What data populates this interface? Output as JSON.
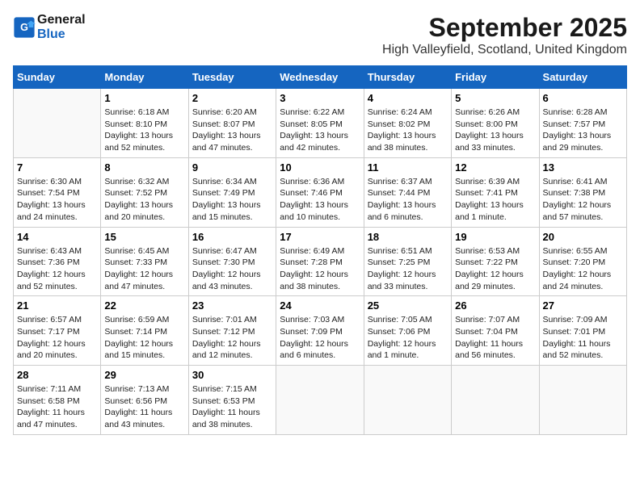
{
  "header": {
    "logo_line1": "General",
    "logo_line2": "Blue",
    "month": "September 2025",
    "location": "High Valleyfield, Scotland, United Kingdom"
  },
  "weekdays": [
    "Sunday",
    "Monday",
    "Tuesday",
    "Wednesday",
    "Thursday",
    "Friday",
    "Saturday"
  ],
  "weeks": [
    [
      {
        "day": "",
        "content": ""
      },
      {
        "day": "1",
        "content": "Sunrise: 6:18 AM\nSunset: 8:10 PM\nDaylight: 13 hours\nand 52 minutes."
      },
      {
        "day": "2",
        "content": "Sunrise: 6:20 AM\nSunset: 8:07 PM\nDaylight: 13 hours\nand 47 minutes."
      },
      {
        "day": "3",
        "content": "Sunrise: 6:22 AM\nSunset: 8:05 PM\nDaylight: 13 hours\nand 42 minutes."
      },
      {
        "day": "4",
        "content": "Sunrise: 6:24 AM\nSunset: 8:02 PM\nDaylight: 13 hours\nand 38 minutes."
      },
      {
        "day": "5",
        "content": "Sunrise: 6:26 AM\nSunset: 8:00 PM\nDaylight: 13 hours\nand 33 minutes."
      },
      {
        "day": "6",
        "content": "Sunrise: 6:28 AM\nSunset: 7:57 PM\nDaylight: 13 hours\nand 29 minutes."
      }
    ],
    [
      {
        "day": "7",
        "content": "Sunrise: 6:30 AM\nSunset: 7:54 PM\nDaylight: 13 hours\nand 24 minutes."
      },
      {
        "day": "8",
        "content": "Sunrise: 6:32 AM\nSunset: 7:52 PM\nDaylight: 13 hours\nand 20 minutes."
      },
      {
        "day": "9",
        "content": "Sunrise: 6:34 AM\nSunset: 7:49 PM\nDaylight: 13 hours\nand 15 minutes."
      },
      {
        "day": "10",
        "content": "Sunrise: 6:36 AM\nSunset: 7:46 PM\nDaylight: 13 hours\nand 10 minutes."
      },
      {
        "day": "11",
        "content": "Sunrise: 6:37 AM\nSunset: 7:44 PM\nDaylight: 13 hours\nand 6 minutes."
      },
      {
        "day": "12",
        "content": "Sunrise: 6:39 AM\nSunset: 7:41 PM\nDaylight: 13 hours\nand 1 minute."
      },
      {
        "day": "13",
        "content": "Sunrise: 6:41 AM\nSunset: 7:38 PM\nDaylight: 12 hours\nand 57 minutes."
      }
    ],
    [
      {
        "day": "14",
        "content": "Sunrise: 6:43 AM\nSunset: 7:36 PM\nDaylight: 12 hours\nand 52 minutes."
      },
      {
        "day": "15",
        "content": "Sunrise: 6:45 AM\nSunset: 7:33 PM\nDaylight: 12 hours\nand 47 minutes."
      },
      {
        "day": "16",
        "content": "Sunrise: 6:47 AM\nSunset: 7:30 PM\nDaylight: 12 hours\nand 43 minutes."
      },
      {
        "day": "17",
        "content": "Sunrise: 6:49 AM\nSunset: 7:28 PM\nDaylight: 12 hours\nand 38 minutes."
      },
      {
        "day": "18",
        "content": "Sunrise: 6:51 AM\nSunset: 7:25 PM\nDaylight: 12 hours\nand 33 minutes."
      },
      {
        "day": "19",
        "content": "Sunrise: 6:53 AM\nSunset: 7:22 PM\nDaylight: 12 hours\nand 29 minutes."
      },
      {
        "day": "20",
        "content": "Sunrise: 6:55 AM\nSunset: 7:20 PM\nDaylight: 12 hours\nand 24 minutes."
      }
    ],
    [
      {
        "day": "21",
        "content": "Sunrise: 6:57 AM\nSunset: 7:17 PM\nDaylight: 12 hours\nand 20 minutes."
      },
      {
        "day": "22",
        "content": "Sunrise: 6:59 AM\nSunset: 7:14 PM\nDaylight: 12 hours\nand 15 minutes."
      },
      {
        "day": "23",
        "content": "Sunrise: 7:01 AM\nSunset: 7:12 PM\nDaylight: 12 hours\nand 12 minutes."
      },
      {
        "day": "24",
        "content": "Sunrise: 7:03 AM\nSunset: 7:09 PM\nDaylight: 12 hours\nand 6 minutes."
      },
      {
        "day": "25",
        "content": "Sunrise: 7:05 AM\nSunset: 7:06 PM\nDaylight: 12 hours\nand 1 minute."
      },
      {
        "day": "26",
        "content": "Sunrise: 7:07 AM\nSunset: 7:04 PM\nDaylight: 11 hours\nand 56 minutes."
      },
      {
        "day": "27",
        "content": "Sunrise: 7:09 AM\nSunset: 7:01 PM\nDaylight: 11 hours\nand 52 minutes."
      }
    ],
    [
      {
        "day": "28",
        "content": "Sunrise: 7:11 AM\nSunset: 6:58 PM\nDaylight: 11 hours\nand 47 minutes."
      },
      {
        "day": "29",
        "content": "Sunrise: 7:13 AM\nSunset: 6:56 PM\nDaylight: 11 hours\nand 43 minutes."
      },
      {
        "day": "30",
        "content": "Sunrise: 7:15 AM\nSunset: 6:53 PM\nDaylight: 11 hours\nand 38 minutes."
      },
      {
        "day": "",
        "content": ""
      },
      {
        "day": "",
        "content": ""
      },
      {
        "day": "",
        "content": ""
      },
      {
        "day": "",
        "content": ""
      }
    ]
  ]
}
